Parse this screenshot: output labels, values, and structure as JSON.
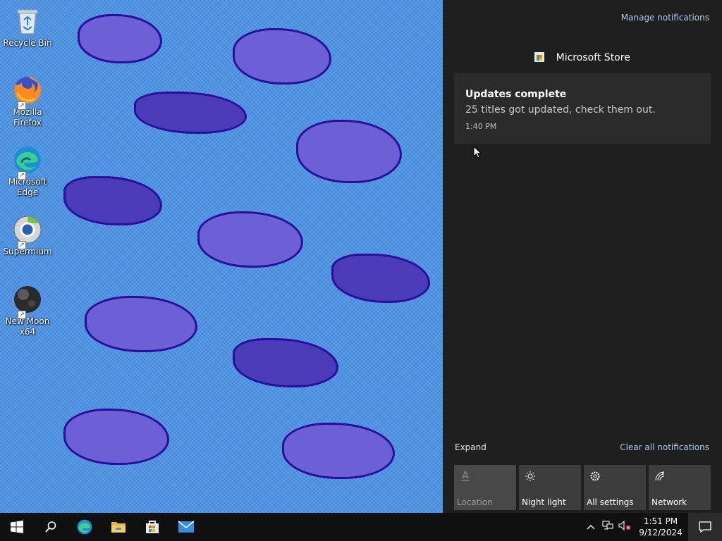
{
  "desktop": {
    "icons": [
      {
        "label": "Recycle Bin",
        "icon": "recycle-bin-icon"
      },
      {
        "label": "Mozilla Firefox",
        "icon": "firefox-icon"
      },
      {
        "label": "Microsoft Edge",
        "icon": "edge-icon"
      },
      {
        "label": "Supermium",
        "icon": "supermium-icon"
      },
      {
        "label": "New Moon x64",
        "icon": "new-moon-icon"
      }
    ]
  },
  "action_center": {
    "manage_label": "Manage notifications",
    "app_name": "Microsoft Store",
    "notification": {
      "title": "Updates complete",
      "body": "25 titles got updated, check them out.",
      "time": "1:40 PM"
    },
    "expand_label": "Expand",
    "clear_label": "Clear all notifications",
    "quick_actions": [
      {
        "label": "Location",
        "icon": "location-icon",
        "enabled": false
      },
      {
        "label": "Night light",
        "icon": "night-light-icon",
        "enabled": true
      },
      {
        "label": "All settings",
        "icon": "gear-icon",
        "enabled": true
      },
      {
        "label": "Network",
        "icon": "network-icon",
        "enabled": true
      }
    ]
  },
  "taskbar": {
    "clock_time": "1:51 PM",
    "clock_date": "9/12/2024",
    "pinned": [
      "start-icon",
      "search-icon",
      "edge-icon",
      "file-explorer-icon",
      "microsoft-store-icon",
      "mail-icon"
    ]
  },
  "colors": {
    "panel_bg": "#1f1f1f",
    "card_bg": "#2b2b2b",
    "link": "#a9c9f0",
    "taskbar_bg": "#101010"
  }
}
